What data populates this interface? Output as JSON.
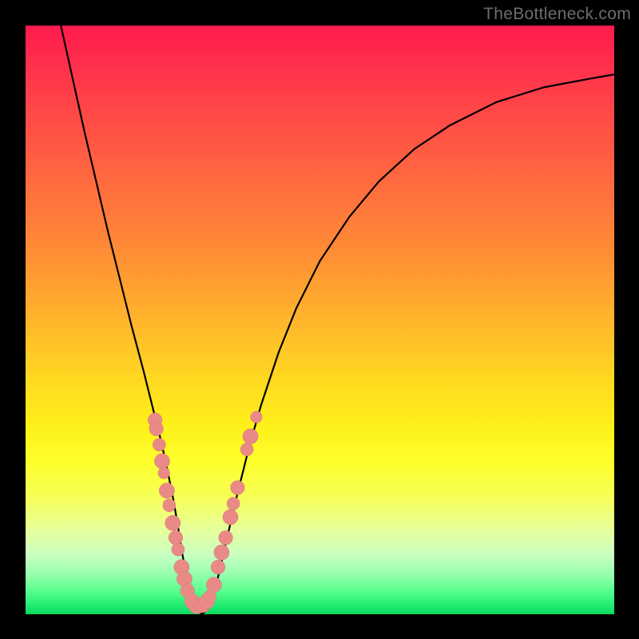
{
  "watermark": "TheBottleneck.com",
  "colors": {
    "curve": "#000000",
    "marker_fill": "#e98a87",
    "marker_stroke": "#d97a77",
    "gradient_top": "#ff1a4e",
    "gradient_bottom": "#10d760"
  },
  "chart_data": {
    "type": "line",
    "title": "",
    "xlabel": "",
    "ylabel": "",
    "xlim": [
      0,
      100
    ],
    "ylim": [
      0,
      100
    ],
    "grid": false,
    "legend": false,
    "series": [
      {
        "name": "bottleneck-curve",
        "x": [
          6,
          8,
          10,
          12,
          14,
          16,
          18,
          20,
          21,
          22,
          23,
          24,
          25,
          25.8,
          26.5,
          27.2,
          28,
          29,
          30,
          31,
          32,
          33,
          34,
          36,
          38,
          40,
          43,
          46,
          50,
          55,
          60,
          66,
          72,
          80,
          88,
          96,
          100
        ],
        "y": [
          100,
          91,
          82,
          73.5,
          65,
          57,
          49,
          41.5,
          37.5,
          33.5,
          29.5,
          25,
          20,
          15.5,
          11,
          7,
          3.2,
          0.8,
          0,
          0.9,
          3.6,
          7.5,
          12,
          20.5,
          28.5,
          35.5,
          44.5,
          52,
          60,
          67.5,
          73.5,
          79,
          83,
          87,
          89.5,
          91,
          91.7
        ]
      }
    ],
    "markers": [
      {
        "x": 22.0,
        "y": 33.0,
        "r": 1.2
      },
      {
        "x": 22.2,
        "y": 31.5,
        "r": 1.2
      },
      {
        "x": 22.7,
        "y": 28.8,
        "r": 1.1
      },
      {
        "x": 23.2,
        "y": 26.0,
        "r": 1.3
      },
      {
        "x": 23.5,
        "y": 24.0,
        "r": 1.0
      },
      {
        "x": 24.0,
        "y": 21.0,
        "r": 1.3
      },
      {
        "x": 24.4,
        "y": 18.5,
        "r": 1.1
      },
      {
        "x": 25.0,
        "y": 15.5,
        "r": 1.3
      },
      {
        "x": 25.5,
        "y": 13.0,
        "r": 1.2
      },
      {
        "x": 25.9,
        "y": 11.0,
        "r": 1.1
      },
      {
        "x": 26.5,
        "y": 8.0,
        "r": 1.3
      },
      {
        "x": 27.0,
        "y": 6.0,
        "r": 1.3
      },
      {
        "x": 27.5,
        "y": 4.0,
        "r": 1.2
      },
      {
        "x": 28.3,
        "y": 2.2,
        "r": 1.3
      },
      {
        "x": 29.0,
        "y": 1.4,
        "r": 1.3
      },
      {
        "x": 29.6,
        "y": 1.3,
        "r": 1.1
      },
      {
        "x": 30.2,
        "y": 1.5,
        "r": 1.2
      },
      {
        "x": 30.8,
        "y": 2.2,
        "r": 1.3
      },
      {
        "x": 31.3,
        "y": 3.0,
        "r": 1.1
      },
      {
        "x": 32.0,
        "y": 5.0,
        "r": 1.3
      },
      {
        "x": 32.7,
        "y": 8.0,
        "r": 1.2
      },
      {
        "x": 33.3,
        "y": 10.5,
        "r": 1.3
      },
      {
        "x": 34.0,
        "y": 13.0,
        "r": 1.2
      },
      {
        "x": 34.8,
        "y": 16.5,
        "r": 1.3
      },
      {
        "x": 35.3,
        "y": 18.8,
        "r": 1.1
      },
      {
        "x": 36.0,
        "y": 21.5,
        "r": 1.2
      },
      {
        "x": 37.6,
        "y": 28.0,
        "r": 1.1
      },
      {
        "x": 38.2,
        "y": 30.2,
        "r": 1.3
      },
      {
        "x": 39.2,
        "y": 33.5,
        "r": 1.0
      }
    ]
  }
}
